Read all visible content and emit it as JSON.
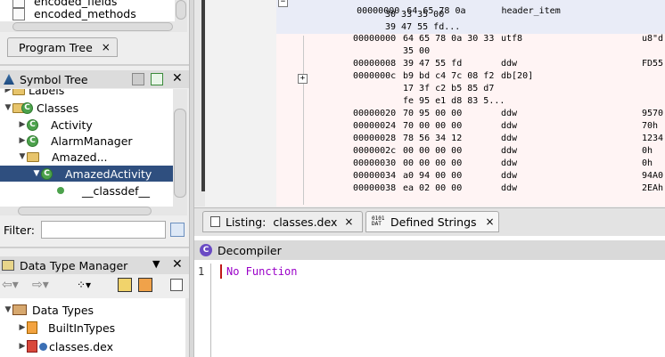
{
  "top_left": {
    "row1": "encoded_fields",
    "row2": "encoded_methods"
  },
  "program_tree_tab": {
    "label": "Program Tree",
    "close": "×"
  },
  "symbol_tree": {
    "title": "Symbol Tree",
    "close": "✕",
    "labels_row": "Labels",
    "classes": "Classes",
    "items": [
      "Activity",
      "AlarmManager",
      "Amazed...",
      "AmazedActivity",
      "__classdef__"
    ]
  },
  "filter": {
    "label": "Filter:",
    "value": ""
  },
  "data_type_manager": {
    "title": "Data Type Manager",
    "close": "✕",
    "root": "Data Types",
    "items": [
      "BuiltInTypes",
      "classes.dex"
    ]
  },
  "listing": {
    "header": {
      "addr": "00000000",
      "bytes": "64 65 78 0a",
      "label": "header_item"
    },
    "header_cont": [
      "30 33 35 00",
      "39 47 55 fd..."
    ],
    "rows": [
      {
        "addr": "00000000",
        "bytes": "64 65 78 0a 30 33",
        "mnem": "utf8",
        "comment": "u8\"d"
      },
      {
        "addr": "",
        "bytes": "35 00",
        "mnem": "",
        "comment": ""
      },
      {
        "addr": "00000008",
        "bytes": "39 47 55 fd",
        "mnem": "ddw",
        "comment": "FD55"
      },
      {
        "addr": "0000000c",
        "bytes": "b9 bd c4 7c 08 f2",
        "mnem": "db[20]",
        "comment": ""
      },
      {
        "addr": "",
        "bytes": "17 3f c2 b5 85 d7",
        "mnem": "",
        "comment": ""
      },
      {
        "addr": "",
        "bytes": "fe 95 e1 d8 83 5...",
        "mnem": "",
        "comment": ""
      },
      {
        "addr": "00000020",
        "bytes": "70 95 00 00",
        "mnem": "ddw",
        "comment": "9570"
      },
      {
        "addr": "00000024",
        "bytes": "70 00 00 00",
        "mnem": "ddw",
        "comment": "70h"
      },
      {
        "addr": "00000028",
        "bytes": "78 56 34 12",
        "mnem": "ddw",
        "comment": "1234"
      },
      {
        "addr": "0000002c",
        "bytes": "00 00 00 00",
        "mnem": "ddw",
        "comment": "0h"
      },
      {
        "addr": "00000030",
        "bytes": "00 00 00 00",
        "mnem": "ddw",
        "comment": "0h"
      },
      {
        "addr": "00000034",
        "bytes": "a0 94 00 00",
        "mnem": "ddw",
        "comment": "94A0"
      },
      {
        "addr": "00000038",
        "bytes": "ea 02 00 00",
        "mnem": "ddw",
        "comment": "2EAh"
      }
    ],
    "tabs": [
      {
        "label": "Listing:  classes.dex",
        "close": "×"
      },
      {
        "label": "Defined Strings",
        "close": "×",
        "icon_text": "0101 DAT"
      }
    ]
  },
  "decompiler": {
    "title": "Decompiler",
    "line_no": "1",
    "text": "No Function"
  },
  "colors": {
    "accent_select": "#2f4f7f",
    "decomp_text": "#9a00c8",
    "listing_bg": "#fff4f4"
  }
}
